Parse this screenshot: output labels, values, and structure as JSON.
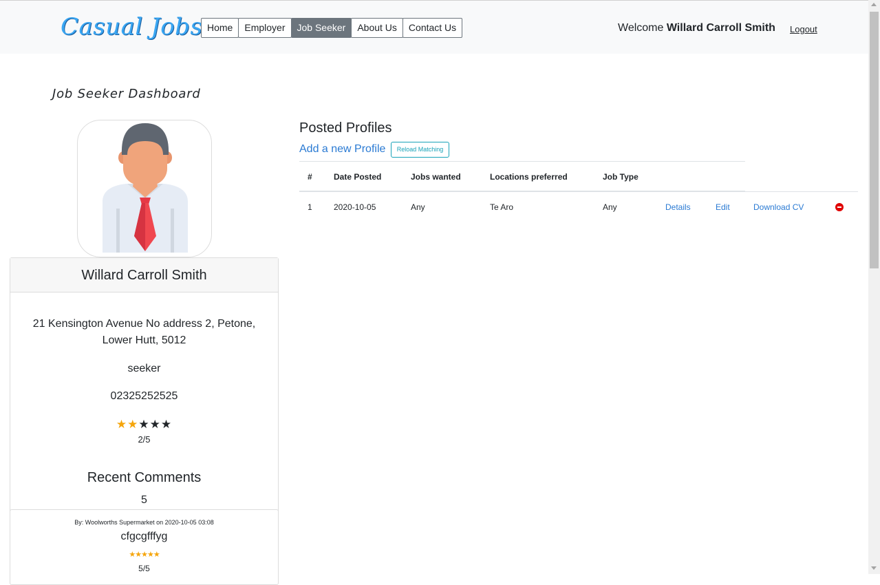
{
  "brand": "Casual Jobs",
  "nav": {
    "items": [
      {
        "label": "Home",
        "active": false
      },
      {
        "label": "Employer",
        "active": false
      },
      {
        "label": "Job Seeker",
        "active": true
      },
      {
        "label": "About Us",
        "active": false
      },
      {
        "label": "Contact Us",
        "active": false
      }
    ],
    "welcome_prefix": "Welcome",
    "user_name": "Willard Carroll Smith",
    "logout": "Logout"
  },
  "sidebar": {
    "title": "Job Seeker Dashboard",
    "avatar_icon": "businessman-avatar-icon",
    "name": "Willard Carroll Smith",
    "address_line1": "21 Kensington Avenue No address 2, Petone,",
    "address_line2": "Lower Hutt, 5012",
    "role": "seeker",
    "phone": "02325252525",
    "rating": 2,
    "rating_max": 5,
    "rating_text": "2/5",
    "recent_comments_title": "Recent Comments",
    "recent_comments_count": "5",
    "comments": [
      {
        "meta": "By: Woolworths Supermarket on 2020-10-05 03:08",
        "text": "cfgcgfffyg",
        "rating": 5,
        "rating_text": "5/5"
      }
    ]
  },
  "main": {
    "title": "Posted Profiles",
    "add_link": "Add a new Profile",
    "reload_button": "Reload Matching",
    "table": {
      "headers": [
        "#",
        "Date Posted",
        "Jobs wanted",
        "Locations preferred",
        "Job Type"
      ],
      "rows": [
        {
          "num": "1",
          "date": "2020-10-05",
          "jobs": "Any",
          "locations": "Te Aro",
          "type": "Any",
          "details": "Details",
          "edit": "Edit",
          "download": "Download CV"
        }
      ]
    }
  },
  "colors": {
    "accent": "#2a7ad3",
    "star_filled": "#f5a50b",
    "star_empty": "#212529",
    "delete": "#e00000",
    "nav_active": "#6c757d"
  }
}
